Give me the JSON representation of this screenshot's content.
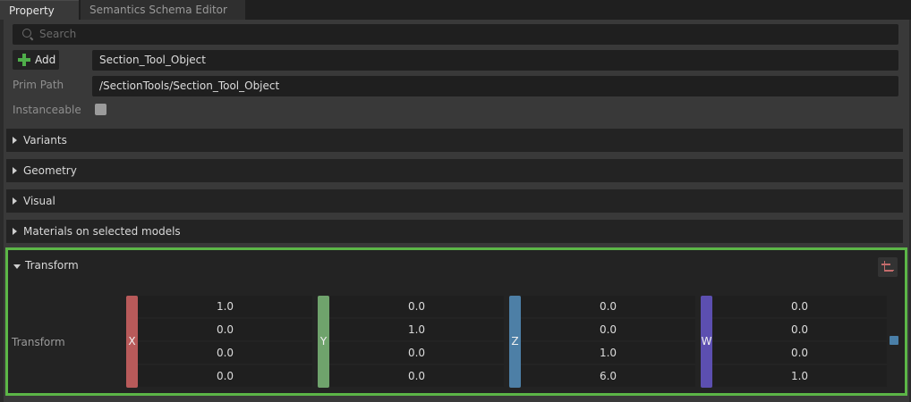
{
  "tabs": [
    {
      "label": "Property",
      "active": true
    },
    {
      "label": "Semantics Schema Editor",
      "active": false
    }
  ],
  "search": {
    "placeholder": "Search"
  },
  "add_button": {
    "label": "Add"
  },
  "name_field": {
    "value": "Section_Tool_Object"
  },
  "prim_path": {
    "label": "Prim Path",
    "value": "/SectionTools/Section_Tool_Object"
  },
  "instanceable": {
    "label": "Instanceable",
    "checked": false
  },
  "sections": [
    "Variants",
    "Geometry",
    "Visual",
    "Materials on selected models"
  ],
  "transform": {
    "section_title": "Transform",
    "row_label": "Transform",
    "columns": [
      {
        "axis": "X",
        "color": "#b85a5a",
        "values": [
          "1.0",
          "0.0",
          "0.0",
          "0.0"
        ]
      },
      {
        "axis": "Y",
        "color": "#6fa36c",
        "values": [
          "0.0",
          "1.0",
          "0.0",
          "0.0"
        ]
      },
      {
        "axis": "Z",
        "color": "#4d7fa6",
        "values": [
          "0.0",
          "0.0",
          "1.0",
          "6.0"
        ]
      },
      {
        "axis": "W",
        "color": "#5c4fb0",
        "values": [
          "0.0",
          "0.0",
          "0.0",
          "1.0"
        ]
      }
    ]
  },
  "colors": {
    "highlight_border": "#5cb647",
    "add_icon": "#4fae4a"
  },
  "icons": {
    "search": "search-icon",
    "add": "plus-icon",
    "reset": "reset-transform-icon"
  }
}
